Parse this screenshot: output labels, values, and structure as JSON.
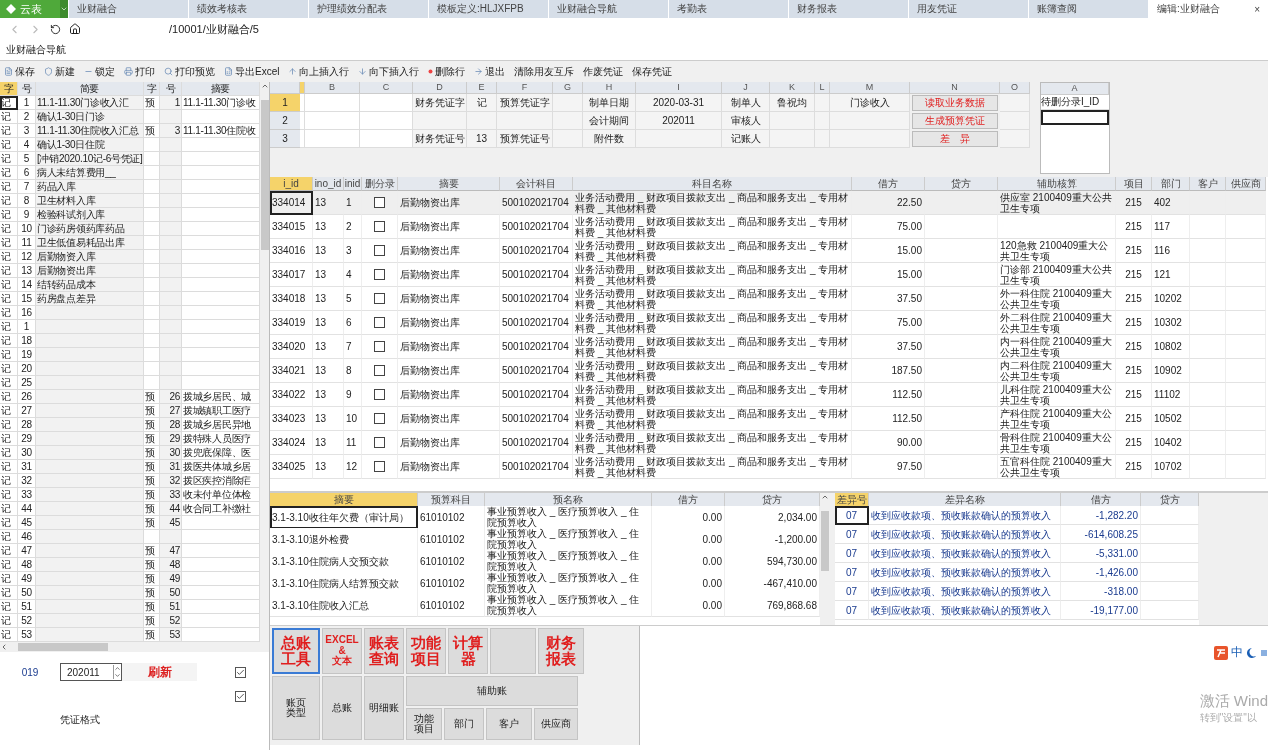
{
  "logo": "云表",
  "tabs": [
    {
      "label": "业财融合",
      "selected": false
    },
    {
      "label": "绩效考核表",
      "selected": false
    },
    {
      "label": "护理绩效分配表",
      "selected": false
    },
    {
      "label": "模板定义:HLJXFPB",
      "selected": false
    },
    {
      "label": "业财融合导航",
      "selected": false
    },
    {
      "label": "考勤表",
      "selected": false
    },
    {
      "label": "财务报表",
      "selected": false
    },
    {
      "label": "用友凭证",
      "selected": false
    },
    {
      "label": "账簿查阅",
      "selected": false
    },
    {
      "label": "编辑:业财融合",
      "selected": true
    }
  ],
  "close": "×",
  "address": "/10001/业财融合/5",
  "page_title": "业财融合导航",
  "toolbar": [
    "保存",
    "新建",
    "锁定",
    "打印",
    "打印预览",
    "导出Excel",
    "向上插入行",
    "向下插入行",
    "删除行",
    "退出",
    "清除用友互斥",
    "作废凭证",
    "保存凭证"
  ],
  "voucher_list": {
    "columns": [
      "字",
      "号",
      "简要",
      "字",
      "号",
      "摘要"
    ],
    "rows": [
      {
        "zi": "记",
        "no": "1",
        "brief": "11.1-11.30门诊收入汇",
        "zi2": "预",
        "no2": "1",
        "summary": "11.1-11.30门诊收",
        "selected": true
      },
      {
        "zi": "记",
        "no": "2",
        "brief": "确认1-30日门诊",
        "selected": false
      },
      {
        "zi": "记",
        "no": "3",
        "brief": "11.1-11.30住院收入汇总",
        "zi2": "预",
        "no2": "3",
        "summary": "11.1-11.30住院收",
        "selected": false
      },
      {
        "zi": "记",
        "no": "4",
        "brief": "确认1-30日住院",
        "selected": false
      },
      {
        "zi": "记",
        "no": "5",
        "brief": "[冲销2020.10记-6号凭证]",
        "selected": false
      },
      {
        "zi": "记",
        "no": "6",
        "brief": "病人未结算费用__",
        "selected": false
      },
      {
        "zi": "记",
        "no": "7",
        "brief": "药品入库",
        "selected": false
      },
      {
        "zi": "记",
        "no": "8",
        "brief": "卫生材料入库",
        "selected": false
      },
      {
        "zi": "记",
        "no": "9",
        "brief": "检验科试剂入库",
        "selected": false
      },
      {
        "zi": "记",
        "no": "10",
        "brief": "门诊药房领药库药品",
        "selected": false
      },
      {
        "zi": "记",
        "no": "11",
        "brief": "卫生低值易耗品出库",
        "selected": false
      },
      {
        "zi": "记",
        "no": "12",
        "brief": "后勤物资入库",
        "selected": false
      },
      {
        "zi": "记",
        "no": "13",
        "brief": "后勤物资出库",
        "selected": false
      },
      {
        "zi": "记",
        "no": "14",
        "brief": "结转药品成本",
        "selected": false
      },
      {
        "zi": "记",
        "no": "15",
        "brief": "药房盘点差异",
        "selected": false
      },
      {
        "zi": "记",
        "no": "16",
        "selected": false
      },
      {
        "zi": "记",
        "no": "1",
        "selected": false
      },
      {
        "zi": "记",
        "no": "18",
        "selected": false
      },
      {
        "zi": "记",
        "no": "19",
        "selected": false
      },
      {
        "zi": "记",
        "no": "20",
        "selected": false
      },
      {
        "zi": "记",
        "no": "25",
        "selected": false
      },
      {
        "zi": "记",
        "no": "26",
        "zi2": "预",
        "no2": "26",
        "summary": "拨城乡居民、城",
        "selected": false
      },
      {
        "zi": "记",
        "no": "27",
        "zi2": "预",
        "no2": "27",
        "summary": "拨城镇职工医疗",
        "selected": false
      },
      {
        "zi": "记",
        "no": "28",
        "zi2": "预",
        "no2": "28",
        "summary": "拨城乡居民异地",
        "selected": false
      },
      {
        "zi": "记",
        "no": "29",
        "zi2": "预",
        "no2": "29",
        "summary": "拨特殊人员医疗",
        "selected": false
      },
      {
        "zi": "记",
        "no": "30",
        "zi2": "预",
        "no2": "30",
        "summary": "拨兜底保障、医",
        "selected": false
      },
      {
        "zi": "记",
        "no": "31",
        "zi2": "预",
        "no2": "31",
        "summary": "拨医共体城乡居",
        "selected": false
      },
      {
        "zi": "记",
        "no": "32",
        "zi2": "预",
        "no2": "32",
        "summary": "拨区疾控消除疟",
        "selected": false
      },
      {
        "zi": "记",
        "no": "33",
        "zi2": "预",
        "no2": "33",
        "summary": "收未付单位体检",
        "selected": false
      },
      {
        "zi": "记",
        "no": "44",
        "zi2": "预",
        "no2": "44",
        "summary": "收合同工补缴社",
        "selected": false
      },
      {
        "zi": "记",
        "no": "45",
        "zi2": "预",
        "no2": "45",
        "selected": false
      },
      {
        "zi": "记",
        "no": "46",
        "selected": false
      },
      {
        "zi": "记",
        "no": "47",
        "zi2": "预",
        "no2": "47",
        "selected": false
      },
      {
        "zi": "记",
        "no": "48",
        "zi2": "预",
        "no2": "48",
        "selected": false
      },
      {
        "zi": "记",
        "no": "49",
        "zi2": "预",
        "no2": "49",
        "selected": false
      },
      {
        "zi": "记",
        "no": "50",
        "zi2": "预",
        "no2": "50",
        "selected": false
      },
      {
        "zi": "记",
        "no": "51",
        "zi2": "预",
        "no2": "51",
        "selected": false
      },
      {
        "zi": "记",
        "no": "52",
        "zi2": "预",
        "no2": "52",
        "selected": false
      },
      {
        "zi": "记",
        "no": "53",
        "zi2": "预",
        "no2": "53",
        "selected": false
      }
    ]
  },
  "list_footer": {
    "code": "019",
    "period": "202011",
    "refresh": "刷新",
    "checks": [
      {
        "checked": true
      },
      {
        "checked": true
      }
    ],
    "format_label": "凭证格式"
  },
  "sheet": {
    "columns": [
      "B",
      "C",
      "D",
      "E",
      "F",
      "G",
      "H",
      "I",
      "J",
      "K",
      "L",
      "M",
      "N",
      "O"
    ],
    "rows": [
      {
        "num": "1",
        "selected": true,
        "cells": {
          "d": "财务凭证字",
          "e": "记",
          "f": "预算凭证字",
          "h": "制单日期",
          "i": "2020-03-31",
          "j": "制单人",
          "k": "鲁祝均",
          "m": "门诊收入"
        },
        "button": "读取业务数据"
      },
      {
        "num": "2",
        "selected": false,
        "cells": {
          "h": "会计期间",
          "i": "202011",
          "j": "审核人"
        },
        "button": "生成预算凭证"
      },
      {
        "num": "3",
        "selected": false,
        "cells": {
          "d": "财务凭证号",
          "e": "13",
          "f": "预算凭证号",
          "h": "附件数",
          "j": "记账人"
        },
        "button": "差　异"
      }
    ]
  },
  "side_sheet": {
    "column": "A",
    "cells": [
      "待删分录I_ID"
    ]
  },
  "entries": {
    "columns": [
      "i_id",
      "ino_id",
      "inid",
      "删分录",
      "摘要",
      "会计科目",
      "科目名称",
      "借方",
      "贷方",
      "辅助核算",
      "项目",
      "部门",
      "客户",
      "供应商"
    ],
    "rows": [
      {
        "i_id": "334014",
        "ino_id": "13",
        "inid": "1",
        "delete": false,
        "summary": "后勤物资出库",
        "account": "500102021704",
        "account_name": "业务活动费用 _ 财政项目拨款支出 _ 商品和服务支出 _ 专用材料费 _ 其他材料费",
        "debit": "22.50",
        "aux": "供应室  2100409重大公共卫生专项",
        "project": "215",
        "dept": "402",
        "selected": true
      },
      {
        "i_id": "334015",
        "ino_id": "13",
        "inid": "2",
        "delete": false,
        "summary": "后勤物资出库",
        "account": "500102021704",
        "account_name": "业务活动费用 _ 财政项目拨款支出 _ 商品和服务支出 _ 专用材料费 _ 其他材料费",
        "debit": "75.00",
        "project": "215",
        "dept": "117",
        "selected": false
      },
      {
        "i_id": "334016",
        "ino_id": "13",
        "inid": "3",
        "delete": false,
        "summary": "后勤物资出库",
        "account": "500102021704",
        "account_name": "业务活动费用 _ 财政项目拨款支出 _ 商品和服务支出 _ 专用材料费 _ 其他材料费",
        "debit": "15.00",
        "aux": "120急救  2100409重大公共卫生专项",
        "project": "215",
        "dept": "116",
        "selected": false
      },
      {
        "i_id": "334017",
        "ino_id": "13",
        "inid": "4",
        "delete": false,
        "summary": "后勤物资出库",
        "account": "500102021704",
        "account_name": "业务活动费用 _ 财政项目拨款支出 _ 商品和服务支出 _ 专用材料费 _ 其他材料费",
        "debit": "15.00",
        "aux": "门诊部  2100409重大公共卫生专项",
        "project": "215",
        "dept": "121",
        "selected": false
      },
      {
        "i_id": "334018",
        "ino_id": "13",
        "inid": "5",
        "delete": false,
        "summary": "后勤物资出库",
        "account": "500102021704",
        "account_name": "业务活动费用 _ 财政项目拨款支出 _ 商品和服务支出 _ 专用材料费 _ 其他材料费",
        "debit": "37.50",
        "aux": "外一科住院  2100409重大公共卫生专项",
        "project": "215",
        "dept": "10202",
        "selected": false
      },
      {
        "i_id": "334019",
        "ino_id": "13",
        "inid": "6",
        "delete": false,
        "summary": "后勤物资出库",
        "account": "500102021704",
        "account_name": "业务活动费用 _ 财政项目拨款支出 _ 商品和服务支出 _ 专用材料费 _ 其他材料费",
        "debit": "75.00",
        "aux": "外二科住院  2100409重大公共卫生专项",
        "project": "215",
        "dept": "10302",
        "selected": false
      },
      {
        "i_id": "334020",
        "ino_id": "13",
        "inid": "7",
        "delete": false,
        "summary": "后勤物资出库",
        "account": "500102021704",
        "account_name": "业务活动费用 _ 财政项目拨款支出 _ 商品和服务支出 _ 专用材料费 _ 其他材料费",
        "debit": "37.50",
        "aux": "内一科住院  2100409重大公共卫生专项",
        "project": "215",
        "dept": "10802",
        "selected": false
      },
      {
        "i_id": "334021",
        "ino_id": "13",
        "inid": "8",
        "delete": false,
        "summary": "后勤物资出库",
        "account": "500102021704",
        "account_name": "业务活动费用 _ 财政项目拨款支出 _ 商品和服务支出 _ 专用材料费 _ 其他材料费",
        "debit": "187.50",
        "aux": "内二科住院  2100409重大公共卫生专项",
        "project": "215",
        "dept": "10902",
        "selected": false
      },
      {
        "i_id": "334022",
        "ino_id": "13",
        "inid": "9",
        "delete": false,
        "summary": "后勤物资出库",
        "account": "500102021704",
        "account_name": "业务活动费用 _ 财政项目拨款支出 _ 商品和服务支出 _ 专用材料费 _ 其他材料费",
        "debit": "112.50",
        "aux": "儿科住院  2100409重大公共卫生专项",
        "project": "215",
        "dept": "11102",
        "selected": false
      },
      {
        "i_id": "334023",
        "ino_id": "13",
        "inid": "10",
        "delete": false,
        "summary": "后勤物资出库",
        "account": "500102021704",
        "account_name": "业务活动费用 _ 财政项目拨款支出 _ 商品和服务支出 _ 专用材料费 _ 其他材料费",
        "debit": "112.50",
        "aux": "产科住院  2100409重大公共卫生专项",
        "project": "215",
        "dept": "10502",
        "selected": false
      },
      {
        "i_id": "334024",
        "ino_id": "13",
        "inid": "11",
        "delete": false,
        "summary": "后勤物资出库",
        "account": "500102021704",
        "account_name": "业务活动费用 _ 财政项目拨款支出 _ 商品和服务支出 _ 专用材料费 _ 其他材料费",
        "debit": "90.00",
        "aux": "骨科住院  2100409重大公共卫生专项",
        "project": "215",
        "dept": "10402",
        "selected": false
      },
      {
        "i_id": "334025",
        "ino_id": "13",
        "inid": "12",
        "delete": false,
        "summary": "后勤物资出库",
        "account": "500102021704",
        "account_name": "业务活动费用 _ 财政项目拨款支出 _ 商品和服务支出 _ 专用材料费 _ 其他材料费",
        "debit": "97.50",
        "aux": "五官科住院  2100409重大公共卫生专项",
        "project": "215",
        "dept": "10702",
        "selected": false
      }
    ]
  },
  "budget": {
    "columns": [
      "摘要",
      "预算科目",
      "预名称",
      "借方",
      "贷方"
    ],
    "rows": [
      {
        "summary": "3.1-3.10收往年欠费（审计局）",
        "code": "61010102",
        "name": "事业预算收入 _ 医疗预算收入 _ 住院预算收入",
        "debit": "0.00",
        "credit": "2,034.00",
        "selected": true
      },
      {
        "summary": "3.1-3.10退外检费",
        "code": "61010102",
        "name": "事业预算收入 _ 医疗预算收入 _ 住院预算收入",
        "debit": "0.00",
        "credit": "-1,200.00",
        "selected": false
      },
      {
        "summary": "3.1-3.10住院病人交预交款",
        "code": "61010102",
        "name": "事业预算收入 _ 医疗预算收入 _ 住院预算收入",
        "debit": "0.00",
        "credit": "594,730.00",
        "selected": false
      },
      {
        "summary": "3.1-3.10住院病人结算预交款",
        "code": "61010102",
        "name": "事业预算收入 _ 医疗预算收入 _ 住院预算收入",
        "debit": "0.00",
        "credit": "-467,410.00",
        "selected": false
      },
      {
        "summary": "3.1-3.10住院收入汇总",
        "code": "61010102",
        "name": "事业预算收入 _ 医疗预算收入 _ 住院预算收入",
        "debit": "0.00",
        "credit": "769,868.68",
        "selected": false
      }
    ]
  },
  "diff": {
    "columns": [
      "差异号",
      "差异名称",
      "借方",
      "贷方"
    ],
    "rows": [
      {
        "code": "07",
        "name": "收到应收款项、预收账款确认的预算收入",
        "debit": "-1,282.20",
        "selected": true
      },
      {
        "code": "07",
        "name": "收到应收款项、预收账款确认的预算收入",
        "debit": "-614,608.25",
        "selected": false
      },
      {
        "code": "07",
        "name": "收到应收款项、预收账款确认的预算收入",
        "debit": "-5,331.00",
        "selected": false
      },
      {
        "code": "07",
        "name": "收到应收款项、预收账款确认的预算收入",
        "debit": "-1,426.00",
        "selected": false
      },
      {
        "code": "07",
        "name": "收到应收款项、预收账款确认的预算收入",
        "debit": "-318.00",
        "selected": false
      },
      {
        "code": "07",
        "name": "收到应收款项、预收账款确认的预算收入",
        "debit": "-19,177.00",
        "selected": false
      }
    ]
  },
  "tools": [
    {
      "lines": [
        "总账",
        "工具"
      ],
      "kind": "big",
      "selected": true
    },
    {
      "lines": [
        "EXCEL",
        "&",
        "文本"
      ],
      "kind": "small",
      "selected": false
    },
    {
      "lines": [
        "账表",
        "查询"
      ],
      "kind": "big",
      "selected": false
    },
    {
      "lines": [
        "功能",
        "项目"
      ],
      "kind": "big",
      "selected": false
    },
    {
      "lines": [
        "计算",
        "器"
      ],
      "kind": "big",
      "selected": false
    },
    {
      "kind": "blank",
      "selected": false
    },
    {
      "lines": [
        "财务",
        "报表"
      ],
      "kind": "big",
      "selected": false
    }
  ],
  "ledgers": {
    "items": [
      {
        "lines": [
          "账页",
          "类型"
        ]
      },
      {
        "lines": [
          "总账"
        ]
      },
      {
        "lines": [
          "明细账"
        ]
      }
    ],
    "aux_title": "辅助账",
    "aux_items": [
      {
        "lines": [
          "功能",
          "项目"
        ]
      },
      {
        "lines": [
          "部门"
        ]
      },
      {
        "lines": [
          "客户"
        ]
      },
      {
        "lines": [
          "供应商"
        ]
      }
    ]
  },
  "ime": "中",
  "activation": [
    "激活 Wind",
    "转到\"设置\"以"
  ]
}
